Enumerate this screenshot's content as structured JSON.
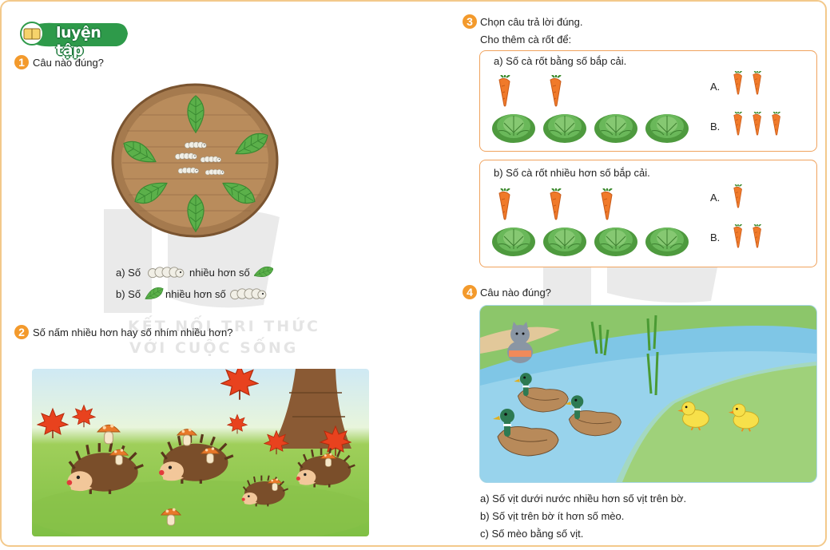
{
  "header": {
    "badge": "luyện tập"
  },
  "q1": {
    "number": "1",
    "title": "Câu nào đúng?",
    "a_prefix": "a) Số",
    "a_middle": "nhiều hơn số",
    "b_prefix": "b) Số",
    "b_middle": "nhiều hơn số"
  },
  "q2": {
    "number": "2",
    "title": "Số nấm nhiều hơn hay số nhím nhiều hơn?"
  },
  "q3": {
    "number": "3",
    "title": "Chọn câu trả lời đúng.",
    "subtitle": "Cho thêm cà rốt để:",
    "part_a": {
      "title": "a) Số cà rốt bằng số bắp cải.",
      "option_a": "A.",
      "option_b": "B."
    },
    "part_b": {
      "title": "b) Số cà rốt nhiều hơn số bắp cải.",
      "option_a": "A.",
      "option_b": "B."
    }
  },
  "q4": {
    "number": "4",
    "title": "Câu nào đúng?",
    "a": "a)  Số vịt dưới nước nhiều hơn số vịt trên bờ.",
    "b": "b)  Số vịt trên bờ ít hơn số mèo.",
    "c": "c)  Số mèo bằng số vịt."
  },
  "watermark": {
    "line1": "KẾT NỐI TRI THỨC",
    "line2": "VỚI CUỘC SỐNG"
  },
  "colors": {
    "accent": "#f39a2c",
    "box_border": "#f0a35e",
    "badge_green": "#2e9a4a",
    "leaf": "#5bb04a",
    "carrot": "#f07a2a",
    "cabbage": "#5aa64a"
  }
}
